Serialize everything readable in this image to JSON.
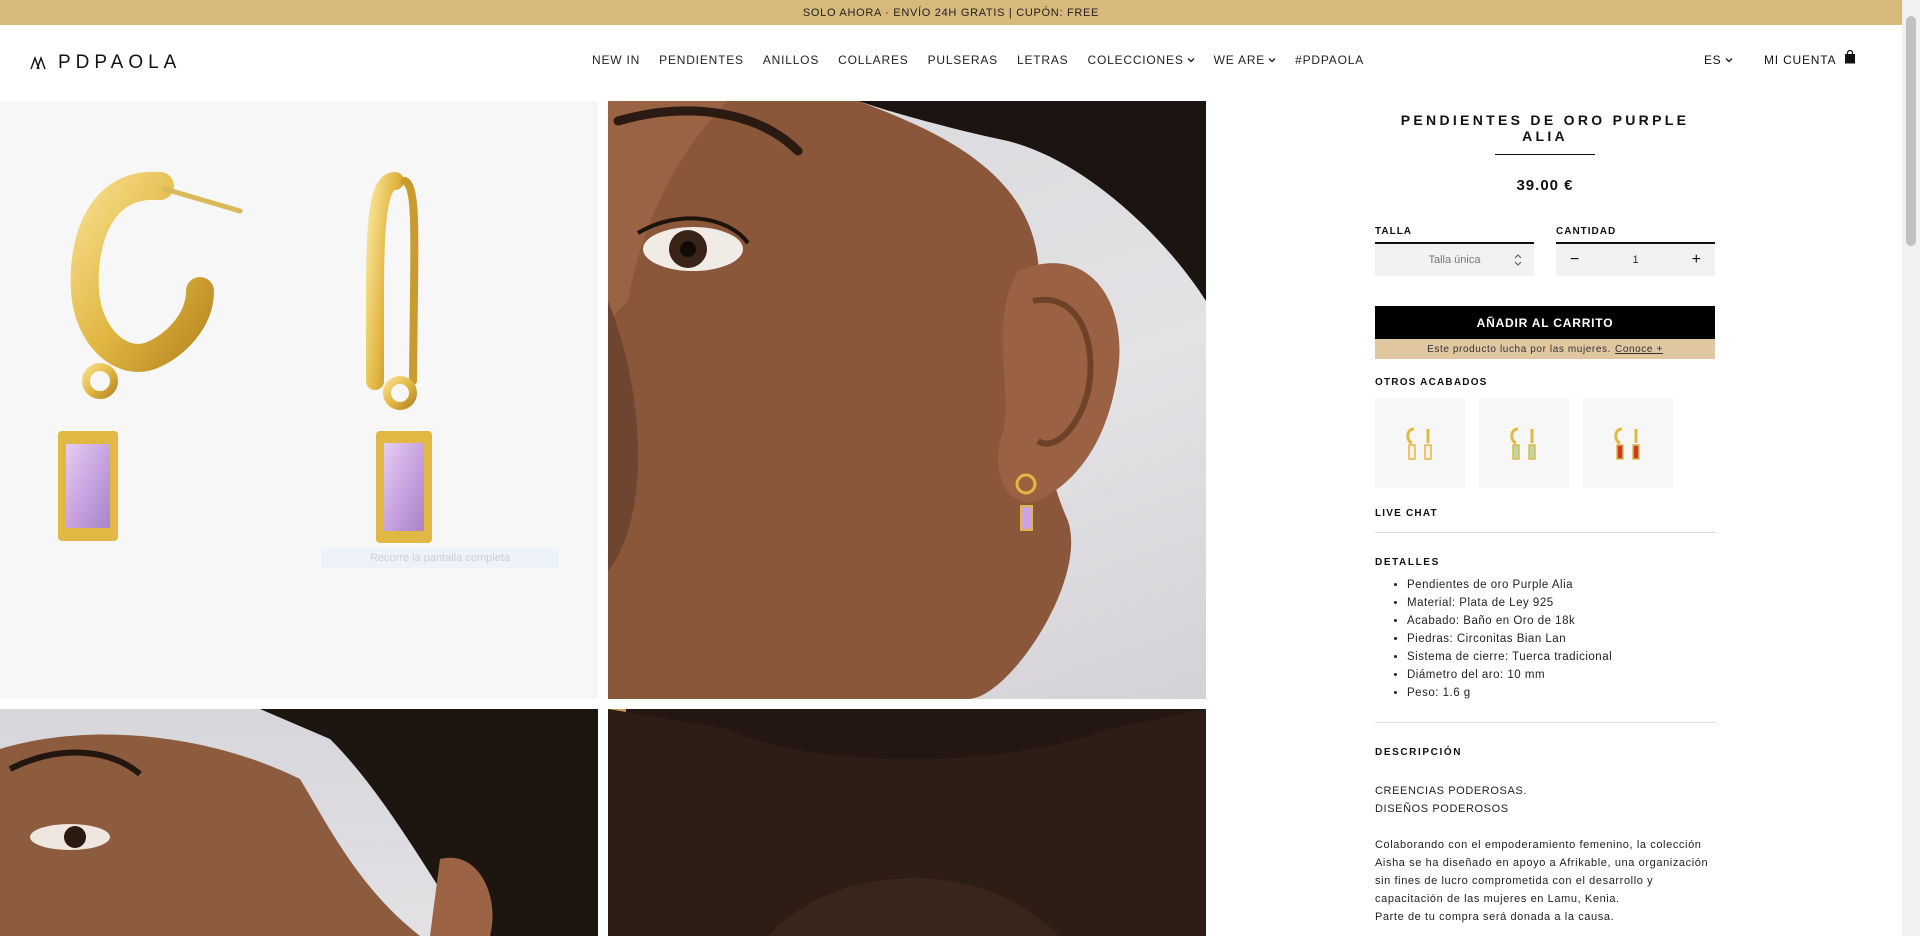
{
  "promo_bar": {
    "text": "SOLO AHORA · ENVÍO 24H GRATIS | CUPÓN: FREE"
  },
  "header": {
    "logo_text": "PDPAOLA",
    "nav": [
      {
        "label": "NEW IN",
        "has_dropdown": false
      },
      {
        "label": "PENDIENTES",
        "has_dropdown": false
      },
      {
        "label": "ANILLOS",
        "has_dropdown": false
      },
      {
        "label": "COLLARES",
        "has_dropdown": false
      },
      {
        "label": "PULSERAS",
        "has_dropdown": false
      },
      {
        "label": "LETRAS",
        "has_dropdown": false
      },
      {
        "label": "COLECCIONES",
        "has_dropdown": true
      },
      {
        "label": "WE ARE",
        "has_dropdown": true
      },
      {
        "label": "#PDPAOLA",
        "has_dropdown": false
      }
    ],
    "language": "ES",
    "account_label": "MI CUENTA",
    "cart_icon": "shopping-bag-icon"
  },
  "gallery": {
    "zoom_hint": "Recorre la pantalla completa"
  },
  "product": {
    "title": "PENDIENTES DE ORO PURPLE ALIA",
    "price": "39.00 €",
    "size": {
      "label": "TALLA",
      "value": "Talla única"
    },
    "quantity": {
      "label": "CANTIDAD",
      "value": "1",
      "minus": "−",
      "plus": "+"
    },
    "add_to_cart": "AÑADIR AL CARRITO",
    "cause_text": "Este producto lucha por las mujeres.",
    "cause_link": "Conoce +",
    "other_finishes_label": "OTROS ACABADOS",
    "live_chat": "LIVE CHAT",
    "details_title": "DETALLES",
    "details": [
      "Pendientes de oro Purple Alia",
      "Material: Plata de Ley 925",
      "Acabado: Baño en Oro de 18k",
      "Piedras: Circonitas Bian Lan",
      "Sistema de cierre: Tuerca tradicional",
      "Diámetro del aro: 10 mm",
      "Peso: 1.6 g"
    ],
    "description_title": "DESCRIPCIÓN",
    "description_lines": [
      "CREENCIAS PODEROSAS.",
      "DISEÑOS PODEROSOS"
    ],
    "description_body": "Colaborando con el empoderamiento femenino, la colección Aisha se ha diseñado en apoyo a Afrikable, una organización sin fines de lucro comprometida con el desarrollo y capacitación de las mujeres en Lamu, Kenia.",
    "description_more": "Parte de tu compra será donada a la causa."
  },
  "colors": {
    "promo_bg": "#d7b97b",
    "cause_bg": "#e0c7a0",
    "gold": "#e2b845",
    "purple_stone": "#c9a4e0"
  }
}
